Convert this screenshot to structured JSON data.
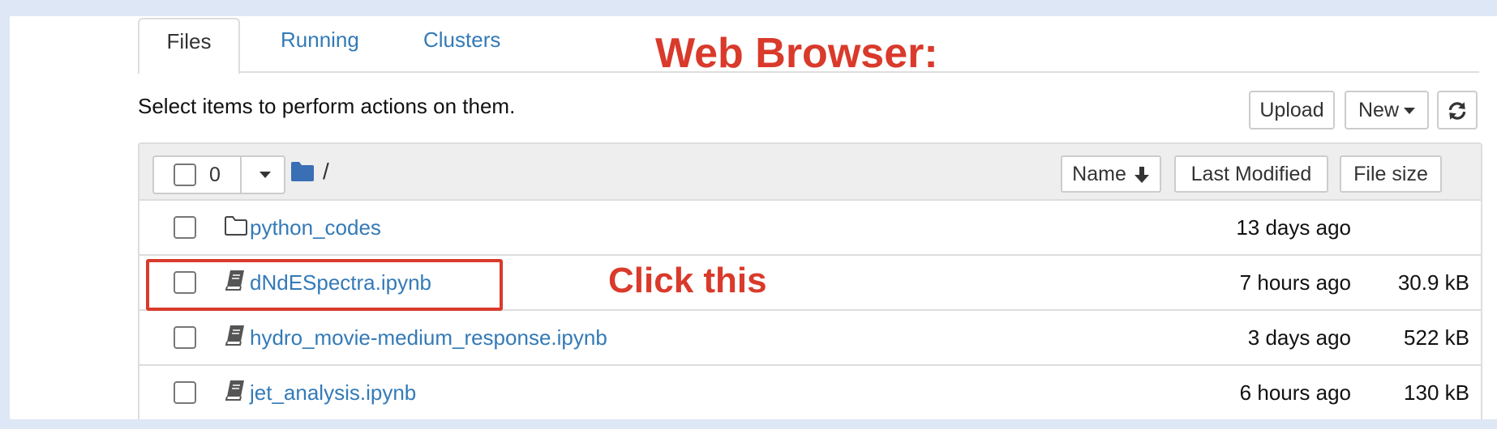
{
  "tabs": [
    {
      "label": "Files",
      "active": true
    },
    {
      "label": "Running",
      "active": false
    },
    {
      "label": "Clusters",
      "active": false
    }
  ],
  "annotations": {
    "title": "Web Browser:",
    "click_hint": "Click this",
    "color": "#d93a2b"
  },
  "toolbar": {
    "instructions": "Select items to perform actions on them.",
    "upload_label": "Upload",
    "new_label": "New",
    "refresh_icon": "refresh-icon"
  },
  "list_header": {
    "selected_count": "0",
    "path": "/",
    "sort_name_label": "Name",
    "last_modified_label": "Last Modified",
    "file_size_label": "File size"
  },
  "files": [
    {
      "name": "python_codes",
      "type": "folder",
      "modified": "13 days ago",
      "size": ""
    },
    {
      "name": "dNdESpectra.ipynb",
      "type": "notebook",
      "modified": "7 hours ago",
      "size": "30.9 kB"
    },
    {
      "name": "hydro_movie-medium_response.ipynb",
      "type": "notebook",
      "modified": "3 days ago",
      "size": "522 kB"
    },
    {
      "name": "jet_analysis.ipynb",
      "type": "notebook",
      "modified": "6 hours ago",
      "size": "130 kB"
    }
  ],
  "colors": {
    "link": "#337ab7",
    "background": "#dee7f5",
    "folder_icon": "#3a6fb5"
  }
}
